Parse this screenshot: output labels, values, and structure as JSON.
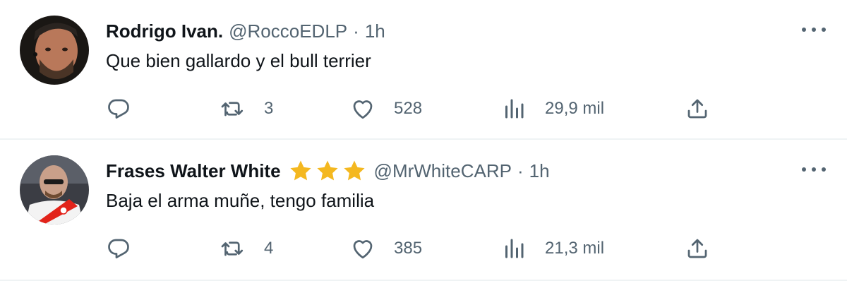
{
  "tweets": [
    {
      "name": "Rodrigo Ivan.",
      "handle": "@RoccoEDLP",
      "separator": "·",
      "time": "1h",
      "text": "Que bien gallardo y el bull terrier",
      "replies": "",
      "retweets": "3",
      "likes": "528",
      "views": "29,9 mil",
      "badge_stars": 0
    },
    {
      "name": "Frases Walter White",
      "handle": "@MrWhiteCARP",
      "separator": "·",
      "time": "1h",
      "text": "Baja el arma muñe, tengo familia",
      "replies": "",
      "retweets": "4",
      "likes": "385",
      "views": "21,3 mil",
      "badge_stars": 3
    }
  ],
  "colors": {
    "text_primary": "#0f1419",
    "text_secondary": "#536471",
    "divider": "#eff3f4",
    "star": "#f4b820"
  },
  "icons": [
    "reply-icon",
    "retweet-icon",
    "like-icon",
    "views-icon",
    "share-icon",
    "more-icon",
    "star-icon"
  ]
}
